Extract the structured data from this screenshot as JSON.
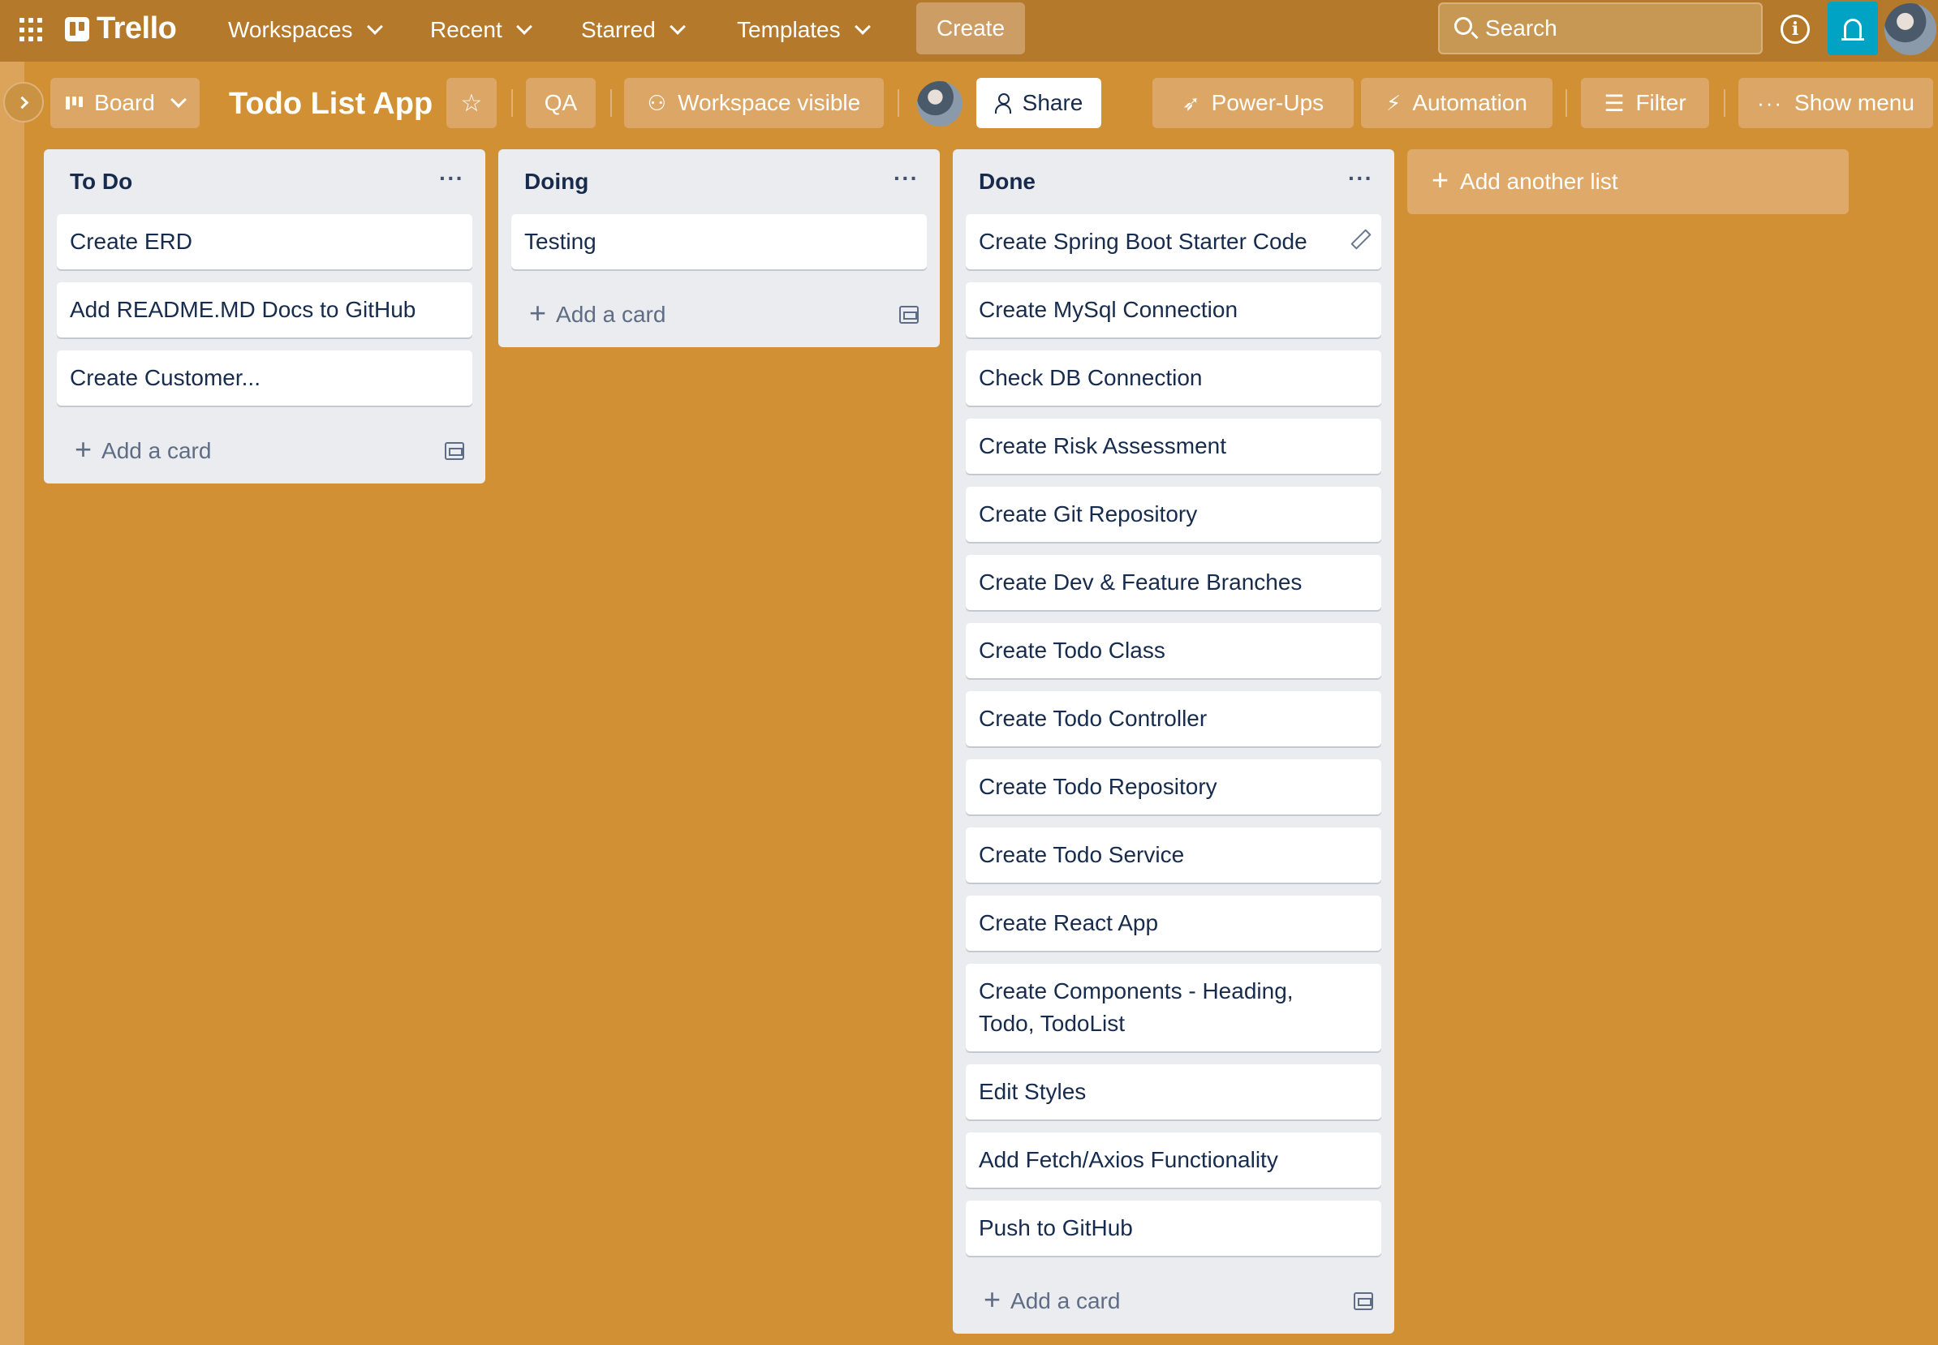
{
  "topnav": {
    "logo": "Trello",
    "items": [
      {
        "label": "Workspaces"
      },
      {
        "label": "Recent"
      },
      {
        "label": "Starred"
      },
      {
        "label": "Templates"
      }
    ],
    "create_label": "Create",
    "search_placeholder": "Search",
    "info_glyph": "i"
  },
  "board_header": {
    "view_label": "Board",
    "title": "Todo List App",
    "qa_label": "QA",
    "visibility_label": "Workspace visible",
    "share_label": "Share",
    "powerups_label": "Power-Ups",
    "automation_label": "Automation",
    "filter_label": "Filter",
    "show_menu_label": "Show menu"
  },
  "lists": [
    {
      "title": "To Do",
      "cards": [
        "Create ERD",
        "Add README.MD Docs to GitHub",
        "Create Customer..."
      ],
      "add_card_label": "Add a card"
    },
    {
      "title": "Doing",
      "cards": [
        "Testing"
      ],
      "add_card_label": "Add a card"
    },
    {
      "title": "Done",
      "cards": [
        "Create Spring Boot Starter Code",
        "Create MySql Connection",
        "Check DB Connection",
        "Create Risk Assessment",
        "Create Git Repository",
        "Create Dev & Feature Branches",
        "Create Todo Class",
        "Create Todo Controller",
        "Create Todo Repository",
        "Create Todo Service",
        "Create React App",
        "Create Components - Heading, Todo, TodoList",
        "Edit Styles",
        "Add Fetch/Axios Functionality",
        "Push to GitHub"
      ],
      "add_card_label": "Add a card"
    }
  ],
  "add_list_label": "Add another list",
  "colors": {
    "board_bg": "#d29034",
    "nav_bg": "#b4792a",
    "list_bg": "#ebecf0",
    "notification_accent": "#00a3c4"
  },
  "icons": {
    "apps": "apps-grid-icon",
    "search": "search-icon",
    "info": "info-icon",
    "bell": "bell-icon",
    "star": "star-icon",
    "edit": "pencil-icon"
  }
}
